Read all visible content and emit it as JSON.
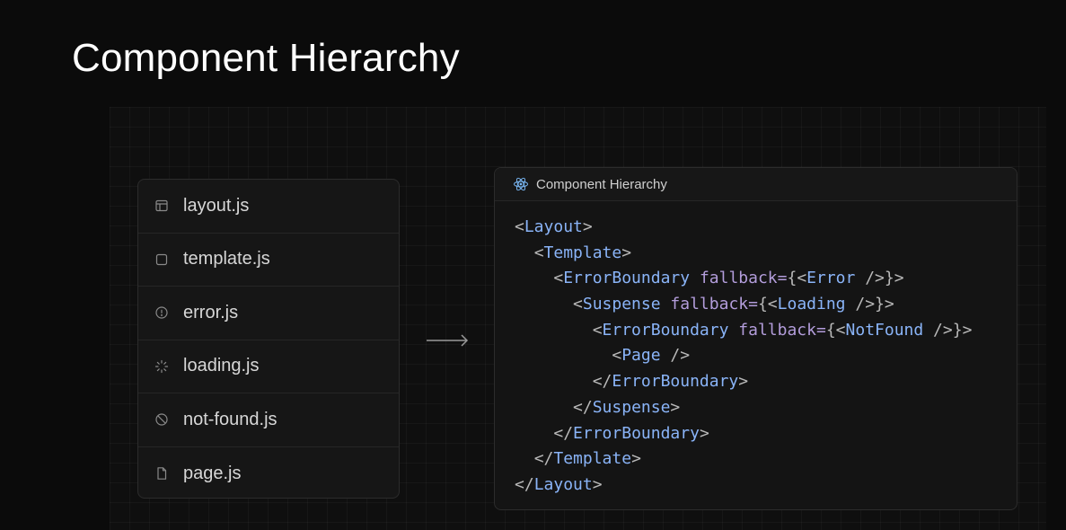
{
  "slide": {
    "title": "Component Hierarchy"
  },
  "files": [
    {
      "name": "layout.js",
      "icon": "layout-icon"
    },
    {
      "name": "template.js",
      "icon": "square-icon"
    },
    {
      "name": "error.js",
      "icon": "error-circle-icon"
    },
    {
      "name": "loading.js",
      "icon": "spinner-icon"
    },
    {
      "name": "not-found.js",
      "icon": "not-found-icon"
    },
    {
      "name": "page.js",
      "icon": "page-icon"
    }
  ],
  "arrow": {
    "icon": "right-arrow-icon"
  },
  "code_panel": {
    "title": "Component Hierarchy",
    "icon": "react-icon",
    "lines": [
      {
        "indent": "",
        "parts": [
          [
            "punct",
            "<"
          ],
          [
            "tag",
            "Layout"
          ],
          [
            "punct",
            ">"
          ]
        ]
      },
      {
        "indent": "  ",
        "parts": [
          [
            "punct",
            "<"
          ],
          [
            "tag",
            "Template"
          ],
          [
            "punct",
            ">"
          ]
        ]
      },
      {
        "indent": "    ",
        "parts": [
          [
            "punct",
            "<"
          ],
          [
            "tag",
            "ErrorBoundary"
          ],
          [
            "punct",
            " "
          ],
          [
            "attr",
            "fallback="
          ],
          [
            "punct",
            "{<"
          ],
          [
            "tag",
            "Error"
          ],
          [
            "punct",
            " />}>"
          ]
        ]
      },
      {
        "indent": "      ",
        "parts": [
          [
            "punct",
            "<"
          ],
          [
            "tag",
            "Suspense"
          ],
          [
            "punct",
            " "
          ],
          [
            "attr",
            "fallback="
          ],
          [
            "punct",
            "{<"
          ],
          [
            "tag",
            "Loading"
          ],
          [
            "punct",
            " />}>"
          ]
        ]
      },
      {
        "indent": "        ",
        "parts": [
          [
            "punct",
            "<"
          ],
          [
            "tag",
            "ErrorBoundary"
          ],
          [
            "punct",
            " "
          ],
          [
            "attr",
            "fallback="
          ],
          [
            "punct",
            "{<"
          ],
          [
            "tag",
            "NotFound"
          ],
          [
            "punct",
            " />}>"
          ]
        ]
      },
      {
        "indent": "          ",
        "parts": [
          [
            "punct",
            "<"
          ],
          [
            "tag",
            "Page"
          ],
          [
            "punct",
            " />"
          ]
        ]
      },
      {
        "indent": "        ",
        "parts": [
          [
            "punct",
            "</"
          ],
          [
            "tag",
            "ErrorBoundary"
          ],
          [
            "punct",
            ">"
          ]
        ]
      },
      {
        "indent": "      ",
        "parts": [
          [
            "punct",
            "</"
          ],
          [
            "tag",
            "Suspense"
          ],
          [
            "punct",
            ">"
          ]
        ]
      },
      {
        "indent": "    ",
        "parts": [
          [
            "punct",
            "</"
          ],
          [
            "tag",
            "ErrorBoundary"
          ],
          [
            "punct",
            ">"
          ]
        ]
      },
      {
        "indent": "  ",
        "parts": [
          [
            "punct",
            "</"
          ],
          [
            "tag",
            "Template"
          ],
          [
            "punct",
            ">"
          ]
        ]
      },
      {
        "indent": "",
        "parts": [
          [
            "punct",
            "</"
          ],
          [
            "tag",
            "Layout"
          ],
          [
            "punct",
            ">"
          ]
        ]
      }
    ]
  },
  "colors": {
    "background": "#0b0b0b",
    "tag": "#8ab4f8",
    "attr": "#b39ddb",
    "punct": "#b9b9b9"
  }
}
